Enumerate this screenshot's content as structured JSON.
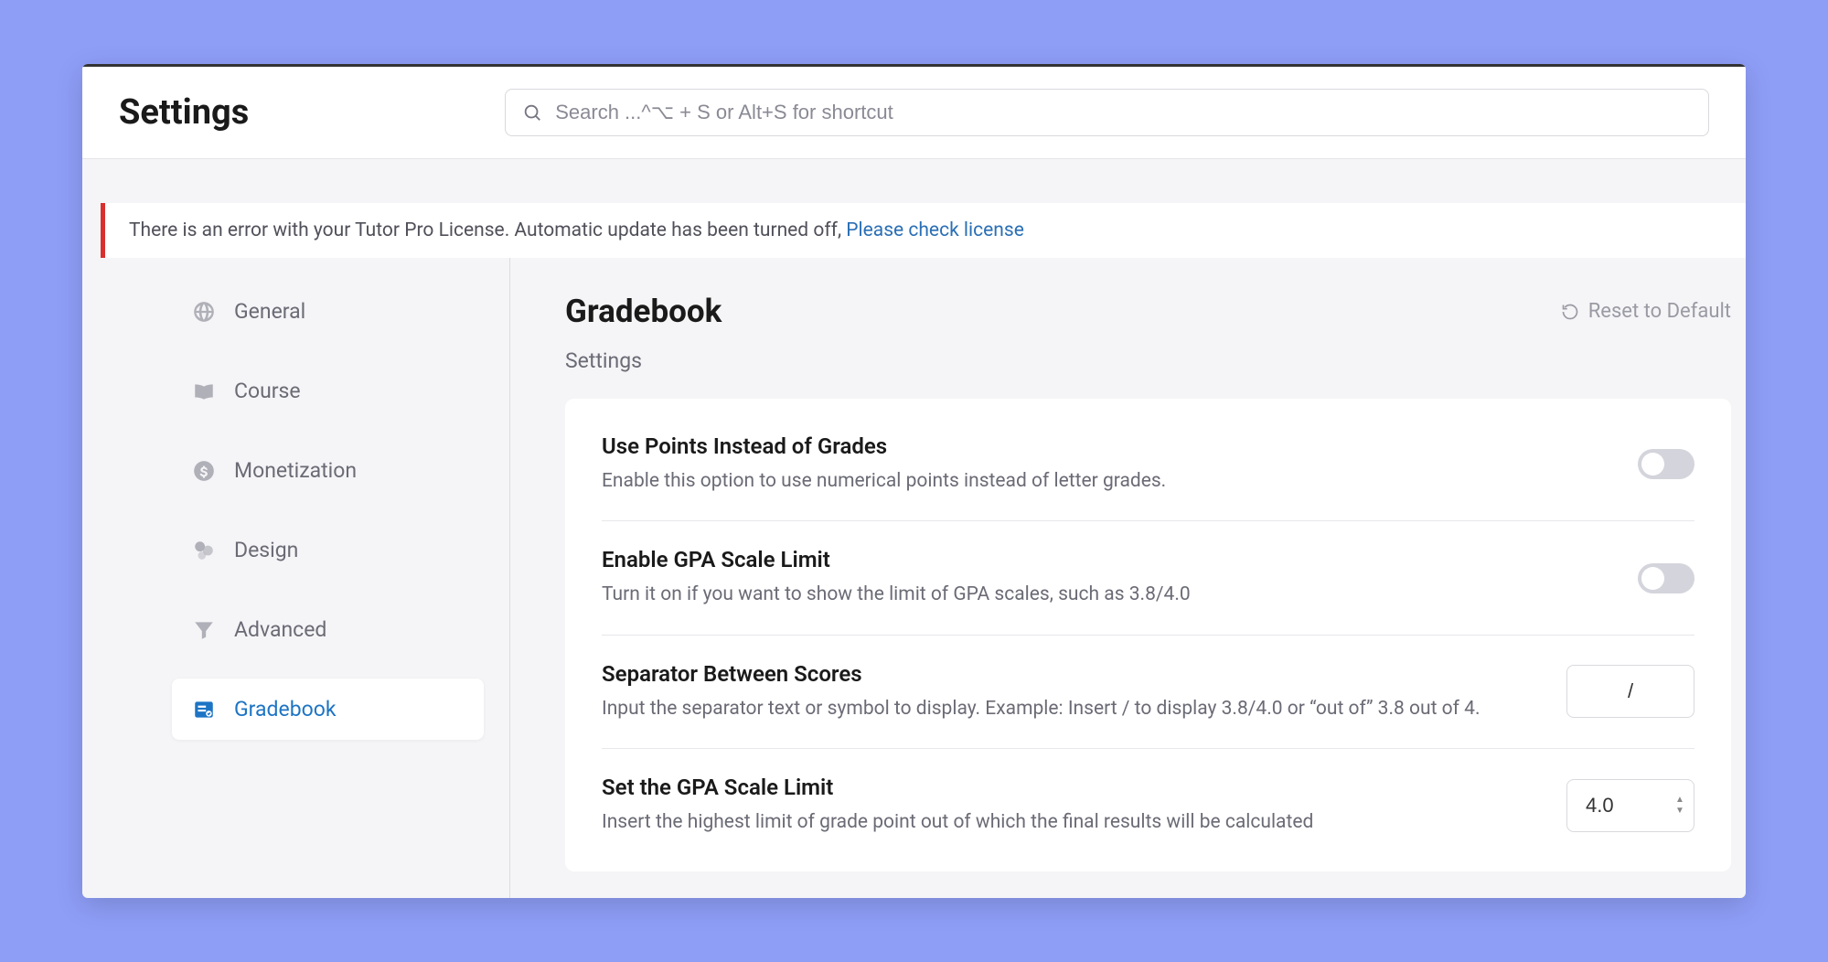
{
  "header": {
    "title": "Settings",
    "search_placeholder": "Search ...^⌥ + S or Alt+S for shortcut"
  },
  "alert": {
    "text": "There is an error with your Tutor Pro License. Automatic update has been turned off, ",
    "link": "Please check license"
  },
  "sidebar": {
    "items": [
      {
        "label": "General"
      },
      {
        "label": "Course"
      },
      {
        "label": "Monetization"
      },
      {
        "label": "Design"
      },
      {
        "label": "Advanced"
      },
      {
        "label": "Gradebook"
      }
    ]
  },
  "main": {
    "title": "Gradebook",
    "reset_label": "Reset to Default",
    "section_label": "Settings",
    "rows": {
      "points": {
        "title": "Use Points Instead of Grades",
        "desc": "Enable this option to use numerical points instead of letter grades.",
        "value": false
      },
      "enable_scale": {
        "title": "Enable GPA Scale Limit",
        "desc": "Turn it on if you want to show the limit of GPA scales, such as 3.8/4.0",
        "value": false
      },
      "separator": {
        "title": "Separator Between Scores",
        "desc": "Input the separator text or symbol to display. Example: Insert / to display 3.8/4.0 or “out of” 3.8 out of 4.",
        "value": "/"
      },
      "set_limit": {
        "title": "Set the GPA Scale Limit",
        "desc": "Insert the highest limit of grade point out of which the final results will be calculated",
        "value": "4.0"
      }
    }
  }
}
